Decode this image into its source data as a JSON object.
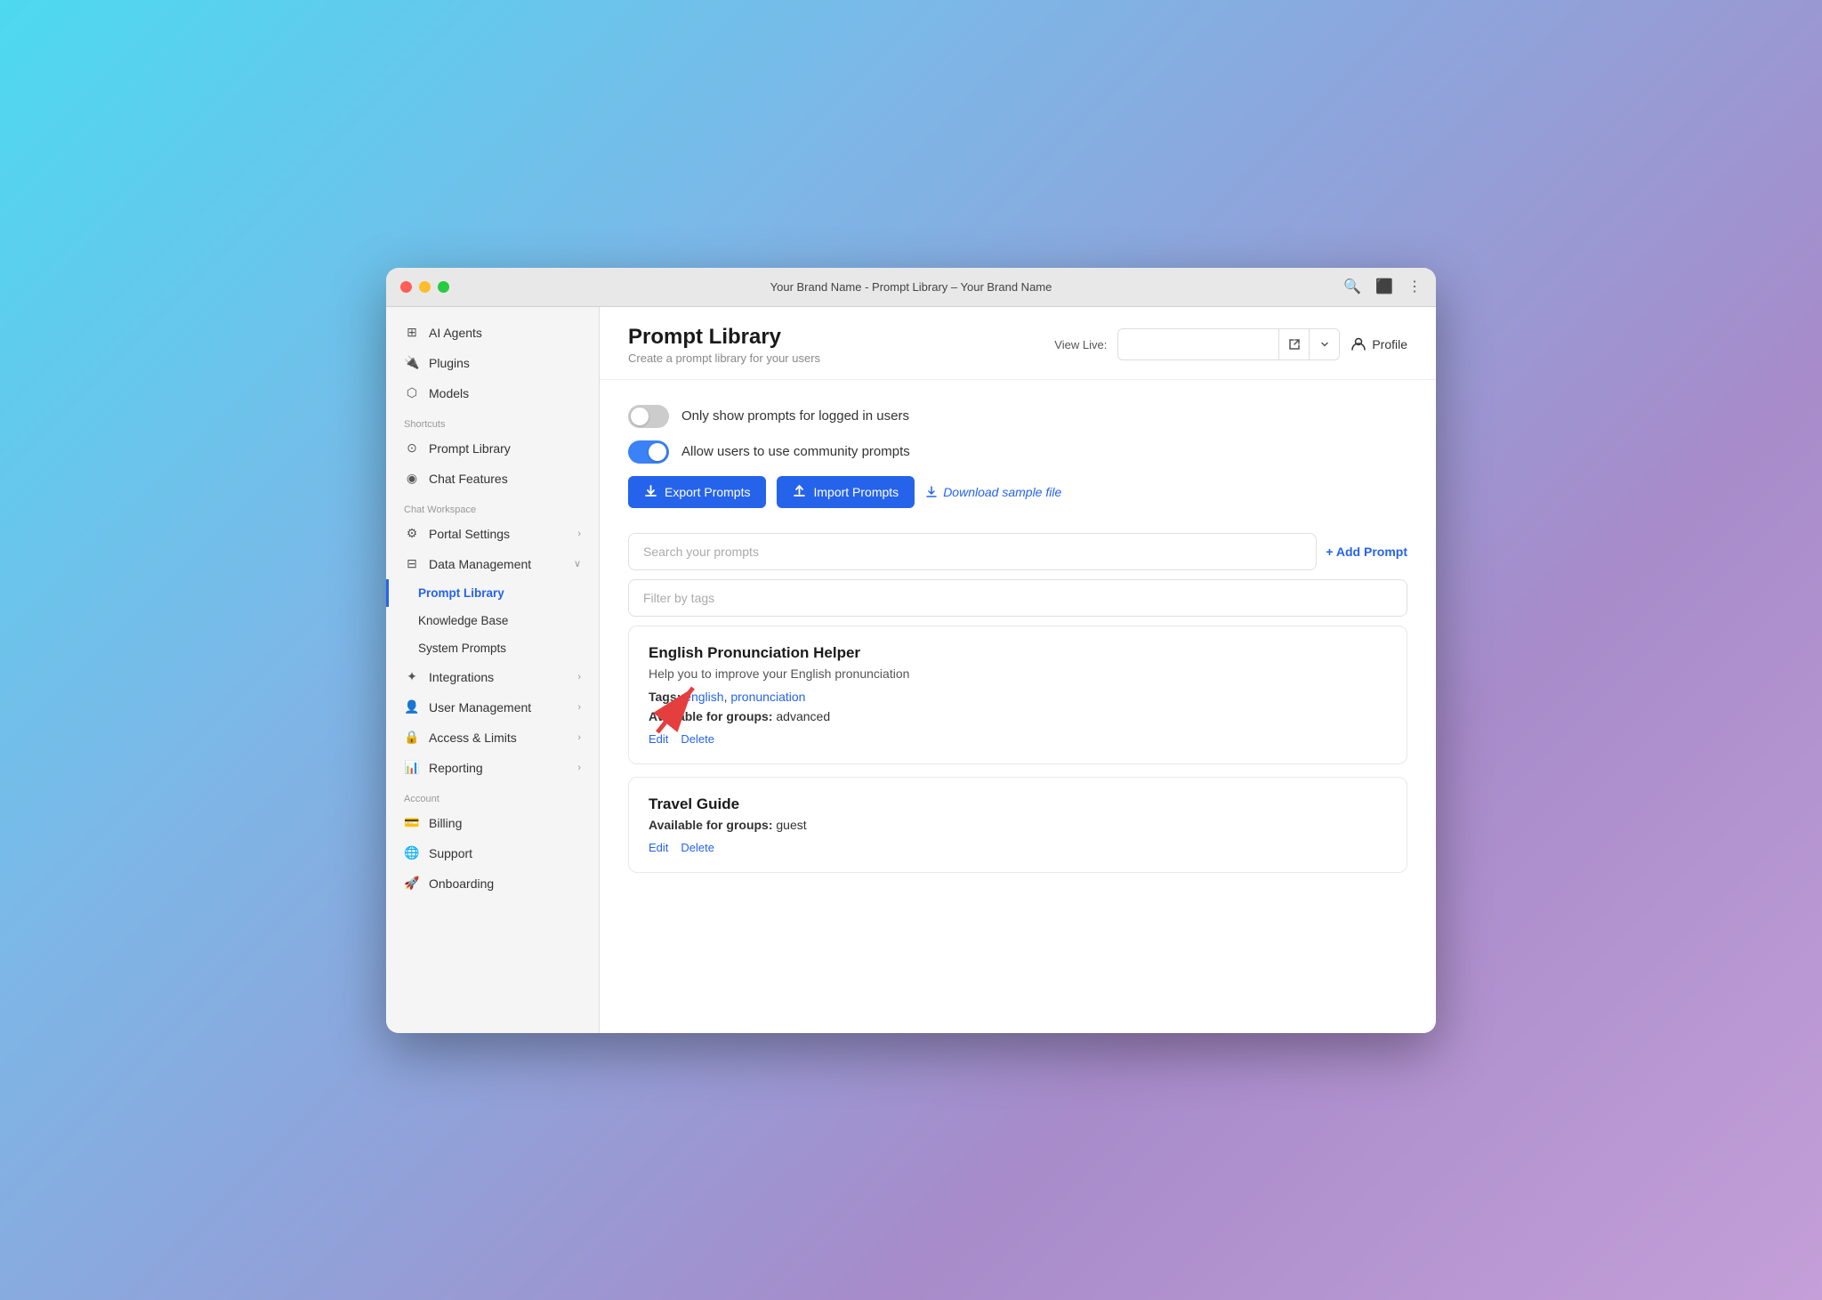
{
  "window": {
    "title": "Your Brand Name - Prompt Library – Your Brand Name",
    "traffic_lights": [
      "red",
      "yellow",
      "green"
    ]
  },
  "titlebar": {
    "title": "Your Brand Name - Prompt Library – Your Brand Name"
  },
  "sidebar": {
    "top_items": [
      {
        "id": "ai-agents",
        "label": "AI Agents",
        "icon": "grid-icon"
      },
      {
        "id": "plugins",
        "label": "Plugins",
        "icon": "plug-icon"
      },
      {
        "id": "models",
        "label": "Models",
        "icon": "cube-icon"
      }
    ],
    "shortcuts_label": "Shortcuts",
    "shortcuts": [
      {
        "id": "prompt-library-shortcut",
        "label": "Prompt Library",
        "icon": "circle-icon"
      },
      {
        "id": "chat-features",
        "label": "Chat Features",
        "icon": "chat-icon"
      }
    ],
    "workspace_label": "Chat Workspace",
    "workspace_items": [
      {
        "id": "portal-settings",
        "label": "Portal Settings",
        "icon": "settings-icon",
        "chevron": true
      },
      {
        "id": "data-management",
        "label": "Data Management",
        "icon": "data-icon",
        "chevron": true,
        "expanded": true
      }
    ],
    "sub_items": [
      {
        "id": "prompt-library-sub",
        "label": "Prompt Library",
        "active": true
      },
      {
        "id": "knowledge-base",
        "label": "Knowledge Base"
      },
      {
        "id": "system-prompts",
        "label": "System Prompts"
      }
    ],
    "integrations": {
      "id": "integrations",
      "label": "Integrations",
      "icon": "integrations-icon",
      "chevron": true
    },
    "user_management": {
      "id": "user-management",
      "label": "User Management",
      "icon": "users-icon",
      "chevron": true
    },
    "access_limits": {
      "id": "access-limits",
      "label": "Access & Limits",
      "icon": "lock-icon",
      "chevron": true
    },
    "reporting": {
      "id": "reporting",
      "label": "Reporting",
      "icon": "chart-icon",
      "chevron": true
    },
    "account_label": "Account",
    "account_items": [
      {
        "id": "billing",
        "label": "Billing",
        "icon": "billing-icon"
      },
      {
        "id": "support",
        "label": "Support",
        "icon": "support-icon"
      },
      {
        "id": "onboarding",
        "label": "Onboarding",
        "icon": "onboarding-icon"
      }
    ]
  },
  "header": {
    "title": "Prompt Library",
    "subtitle": "Create a prompt library for your users",
    "view_live_label": "View Live:",
    "view_live_placeholder": "",
    "profile_label": "Profile"
  },
  "toggles": [
    {
      "id": "logged-in-toggle",
      "label": "Only show prompts for logged in users",
      "on": false
    },
    {
      "id": "community-toggle",
      "label": "Allow users to use community prompts",
      "on": true
    }
  ],
  "buttons": {
    "export": "Export Prompts",
    "import": "Import Prompts",
    "download": "Download sample file"
  },
  "search": {
    "placeholder": "Search your prompts",
    "filter_placeholder": "Filter by tags",
    "add_prompt": "+ Add Prompt"
  },
  "prompts": [
    {
      "id": "english-pronunciation",
      "title": "English Pronunciation Helper",
      "description": "Help you to improve your English pronunciation",
      "tags": [
        "english",
        "pronunciation"
      ],
      "groups": "advanced",
      "edit_label": "Edit",
      "delete_label": "Delete"
    },
    {
      "id": "travel-guide",
      "title": "Travel Guide",
      "description": "",
      "tags": [],
      "groups": "guest",
      "edit_label": "Edit",
      "delete_label": "Delete"
    }
  ]
}
